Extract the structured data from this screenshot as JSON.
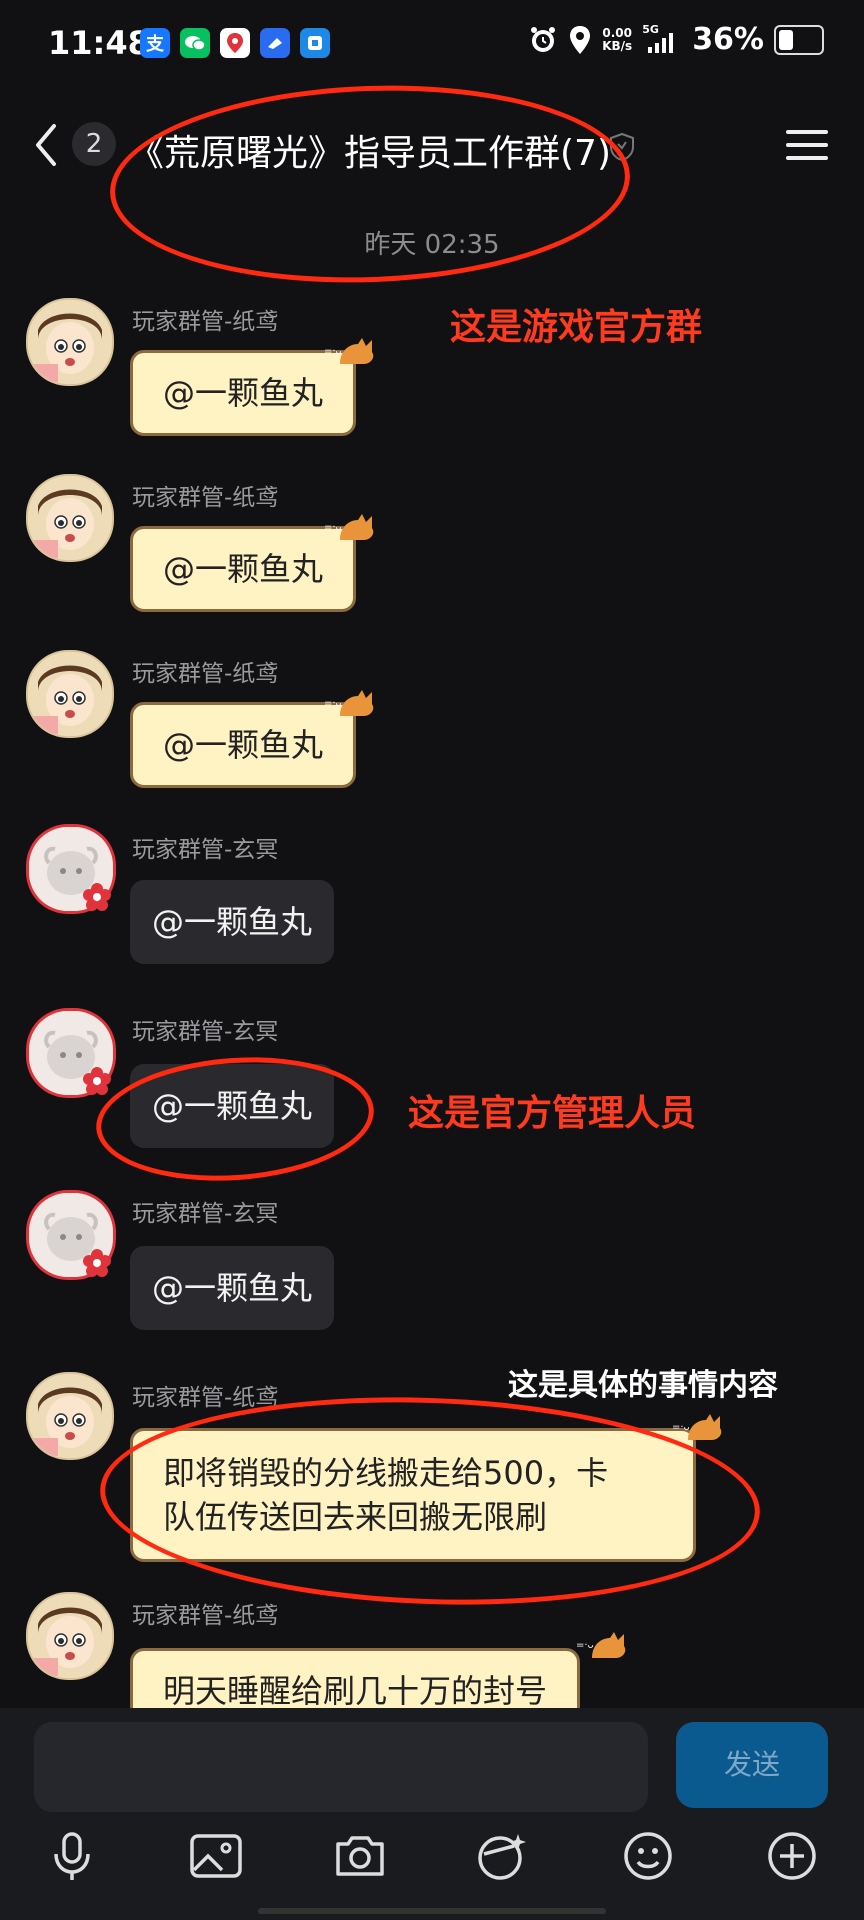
{
  "status_bar": {
    "time": "11:48",
    "apps": [
      {
        "glyph": "支",
        "color": "#1677ff"
      },
      {
        "glyph": "✉",
        "color": "#07c160"
      },
      {
        "glyph": "⬤",
        "color": "#e0333b"
      },
      {
        "glyph": "◐",
        "color": "#2a6cf0"
      },
      {
        "glyph": "■",
        "color": "#1e88e5"
      }
    ],
    "net_speed_value": "0.00",
    "net_speed_unit": "KB/s",
    "signal_label": "5G",
    "battery": "36%",
    "battery_level": 0.36
  },
  "header": {
    "back_icon": "chevron-left-icon",
    "unread_count": "2",
    "title": "《荒原曙光》指导员工作群(7)",
    "menu_icon": "hamburger-icon"
  },
  "chat": {
    "timestamp": "昨天 02:35",
    "messages": [
      {
        "sender": "玩家群管-纸鸢",
        "text": "@一颗鱼丸"
      },
      {
        "sender": "玩家群管-纸鸢",
        "text": "@一颗鱼丸"
      },
      {
        "sender": "玩家群管-纸鸢",
        "text": "@一颗鱼丸"
      },
      {
        "sender": "玩家群管-玄冥",
        "text": "@一颗鱼丸"
      },
      {
        "sender": "玩家群管-玄冥",
        "text": "@一颗鱼丸"
      },
      {
        "sender": "玩家群管-玄冥",
        "text": "@一颗鱼丸"
      },
      {
        "sender": "玩家群管-纸鸢",
        "text_line1": "即将销毁的分线搬走给500，卡",
        "text_line2": "队伍传送回去来回搬无限刷"
      },
      {
        "sender": "玩家群管-纸鸢",
        "text": "明天睡醒给刷几十万的封号"
      }
    ]
  },
  "annotations": {
    "official_group": "这是游戏官方群",
    "official_admin": "这是官方管理人员",
    "details": "这是具体的事情内容"
  },
  "input_bar": {
    "placeholder": "",
    "send_label": "发送",
    "send_color": "#0a5a8f",
    "tools": [
      "microphone-icon",
      "image-icon",
      "camera-icon",
      "sticker-icon",
      "emoji-icon",
      "plus-icon"
    ]
  },
  "colors": {
    "annotation_red": "#ff3b1f",
    "bubble_yellow": "#fff3c4",
    "background": "#111113"
  }
}
